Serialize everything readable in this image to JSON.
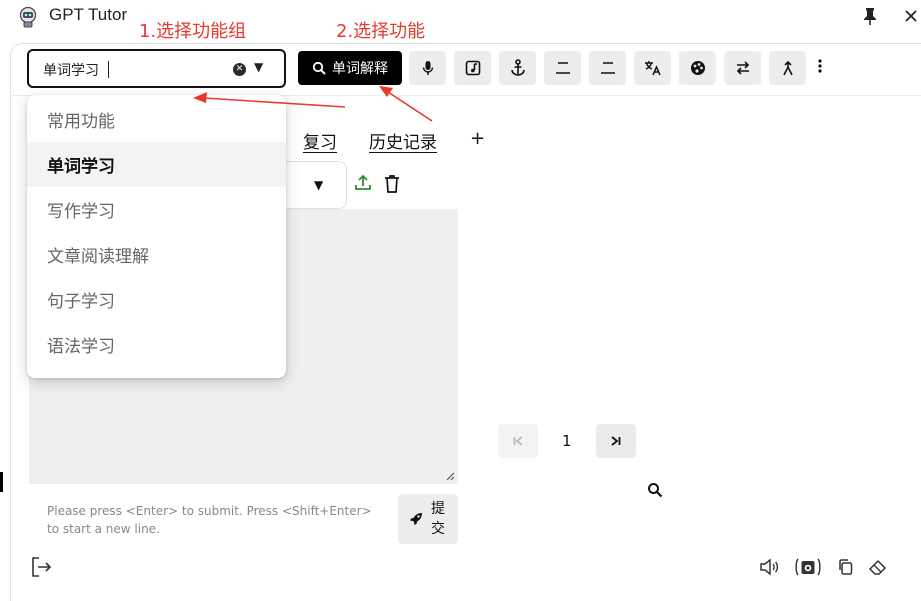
{
  "app": {
    "title": "GPT Tutor"
  },
  "annotations": {
    "step1": "1.选择功能组",
    "step2": "2.选择功能"
  },
  "group_select": {
    "value": "单词学习"
  },
  "menu": {
    "items": [
      {
        "label": "常用功能",
        "active": false
      },
      {
        "label": "单词学习",
        "active": true
      },
      {
        "label": "写作学习",
        "active": false
      },
      {
        "label": "文章阅读理解",
        "active": false
      },
      {
        "label": "句子学习",
        "active": false
      },
      {
        "label": "语法学习",
        "active": false
      }
    ]
  },
  "toolbar": {
    "primary_label": "单词解释",
    "buttons": [
      "mic-icon",
      "music-note-icon",
      "anchor-icon",
      "heading-icon",
      "heading-icon",
      "translate-icon",
      "palette-icon",
      "swap-icon",
      "merge-icon"
    ]
  },
  "tabs": {
    "review": "复习",
    "history": "历史记录",
    "add": "+"
  },
  "input": {
    "hint": "Please press <Enter> to submit. Press <Shift+Enter> to start a new line."
  },
  "submit": {
    "label": "提交"
  },
  "pagination": {
    "current": "1"
  },
  "colors": {
    "annotation": "#e8392e",
    "primary": "#000000",
    "upload": "#2e8b2e"
  }
}
